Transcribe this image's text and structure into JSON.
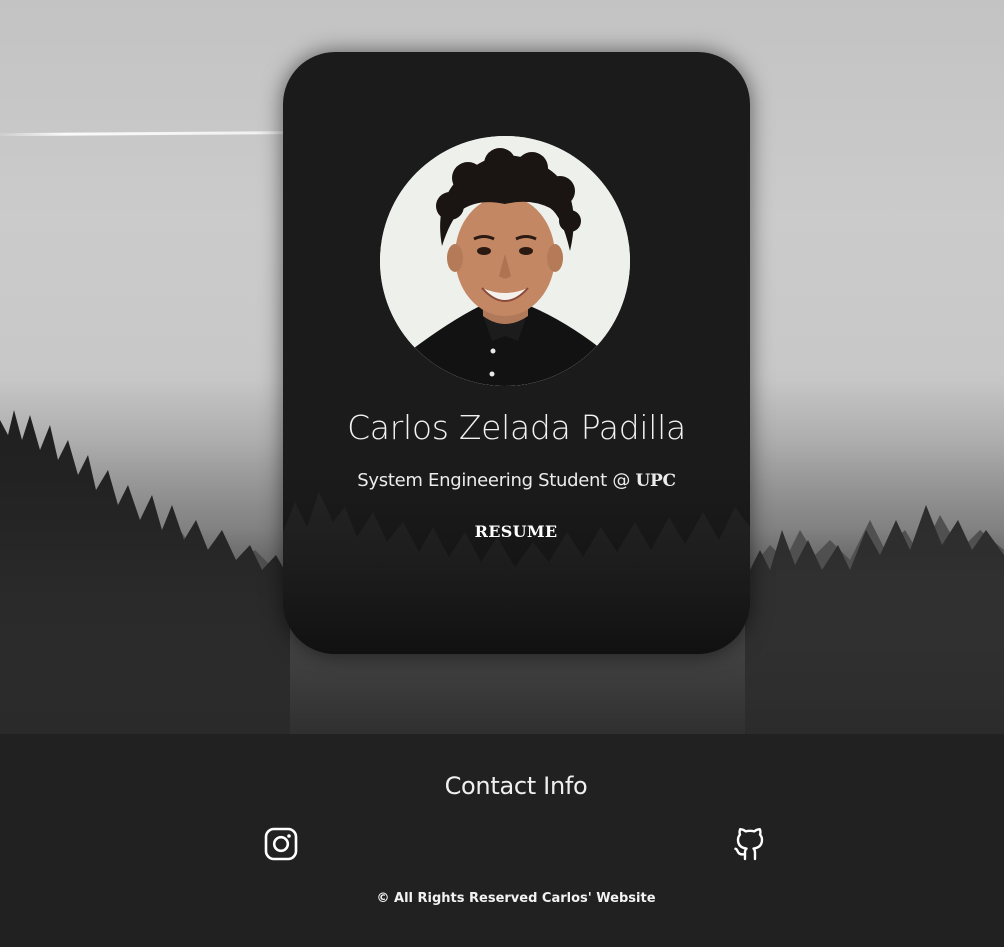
{
  "profile": {
    "name": "Carlos Zelada Padilla",
    "role": "System Engineering Student @",
    "organization": "UPC",
    "resume_label": "RESUME",
    "photo_icon": "profile-photo"
  },
  "footer": {
    "title": "Contact Info",
    "links": [
      {
        "icon": "instagram-icon",
        "label": "Instagram"
      },
      {
        "icon": "github-icon",
        "label": "GitHub"
      }
    ],
    "copyright": "© All Rights Reserved Carlos' Website"
  },
  "colors": {
    "card_bg": "#1b1b1b",
    "footer_bg": "#212121",
    "text": "#f2f2f2"
  }
}
